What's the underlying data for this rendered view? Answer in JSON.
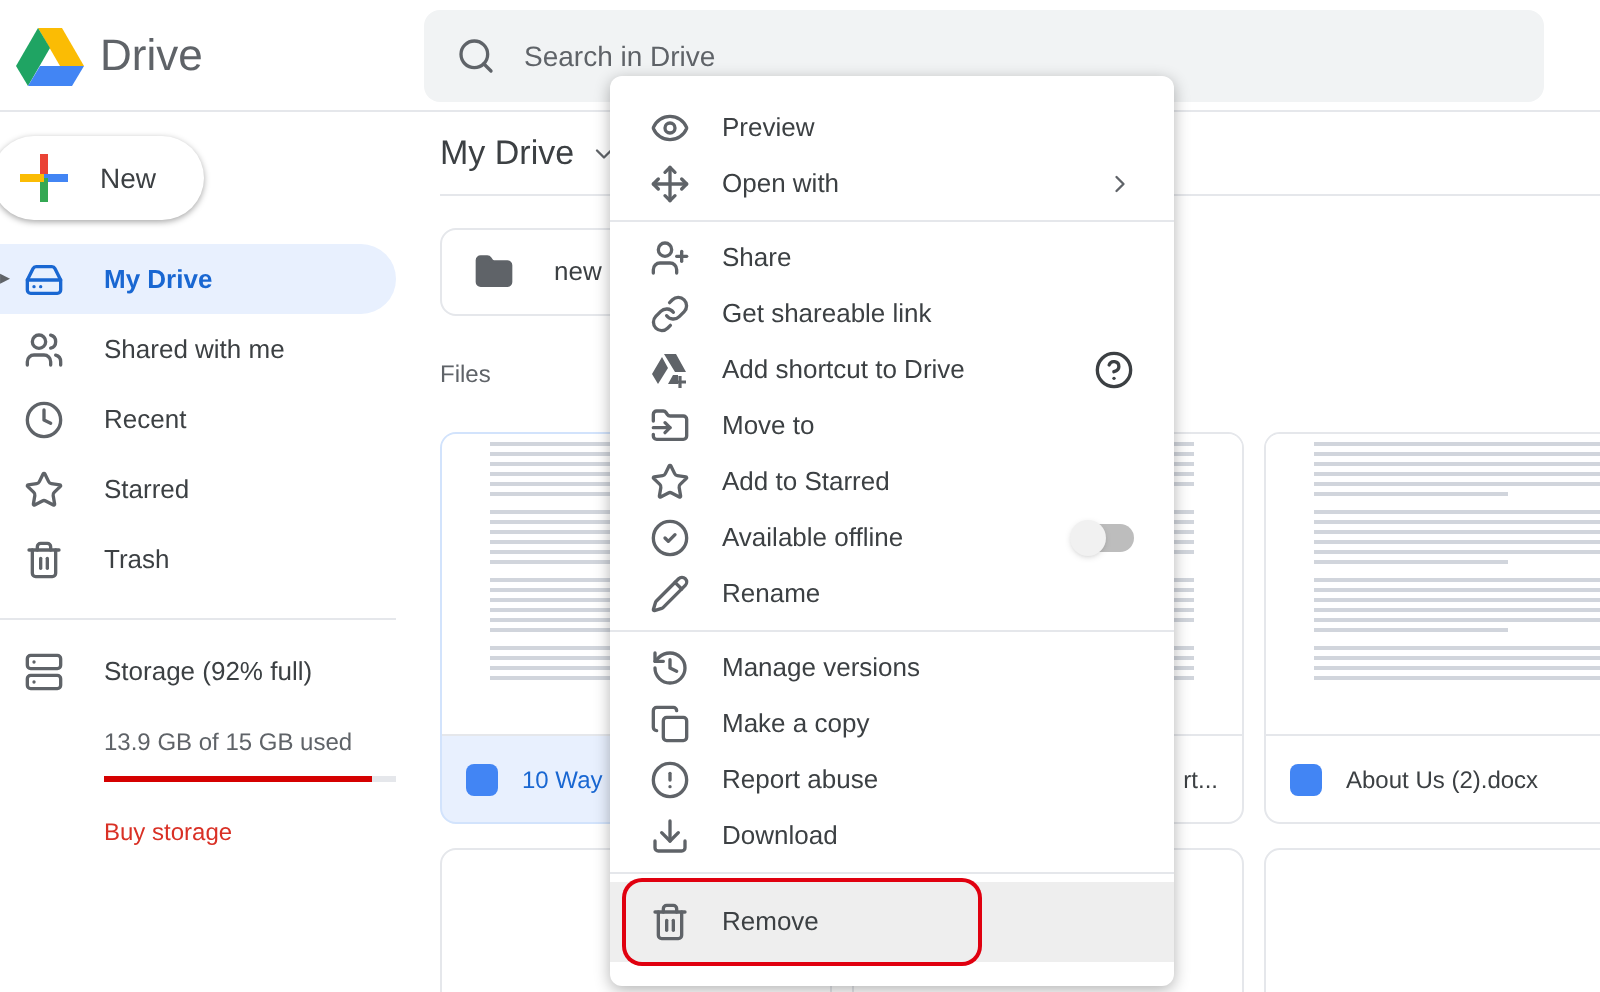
{
  "app": {
    "name": "Drive"
  },
  "search": {
    "placeholder": "Search in Drive"
  },
  "new_button": {
    "label": "New"
  },
  "sidebar": {
    "items": [
      {
        "label": "My Drive",
        "selected": true,
        "expander": "▸"
      },
      {
        "label": "Shared with me",
        "selected": false
      },
      {
        "label": "Recent",
        "selected": false
      },
      {
        "label": "Starred",
        "selected": false
      },
      {
        "label": "Trash",
        "selected": false
      }
    ],
    "storage": {
      "label": "Storage (92% full)",
      "usage": "13.9 GB of 15 GB used",
      "level": 0.92,
      "buy": "Buy storage"
    }
  },
  "header": {
    "title": "My Drive"
  },
  "folders": [
    {
      "name": "new"
    }
  ],
  "files_heading": "Files",
  "files": [
    {
      "name": "10 Way",
      "selected": true
    },
    {
      "name": "rt...",
      "selected": false
    },
    {
      "name": "About Us (2).docx",
      "selected": false
    }
  ],
  "context_menu": {
    "groups": [
      [
        {
          "label": "Preview",
          "kind": "item"
        },
        {
          "label": "Open with",
          "kind": "submenu"
        }
      ],
      [
        {
          "label": "Share",
          "kind": "item"
        },
        {
          "label": "Get shareable link",
          "kind": "item"
        },
        {
          "label": "Add shortcut to Drive",
          "kind": "help"
        },
        {
          "label": "Move to",
          "kind": "item"
        },
        {
          "label": "Add to Starred",
          "kind": "item"
        },
        {
          "label": "Available offline",
          "kind": "toggle",
          "on": false
        },
        {
          "label": "Rename",
          "kind": "item"
        }
      ],
      [
        {
          "label": "Manage versions",
          "kind": "item"
        },
        {
          "label": "Make a copy",
          "kind": "item"
        },
        {
          "label": "Report abuse",
          "kind": "item"
        },
        {
          "label": "Download",
          "kind": "item"
        }
      ],
      [
        {
          "label": "Remove",
          "kind": "item",
          "highlighted": true
        }
      ]
    ]
  }
}
